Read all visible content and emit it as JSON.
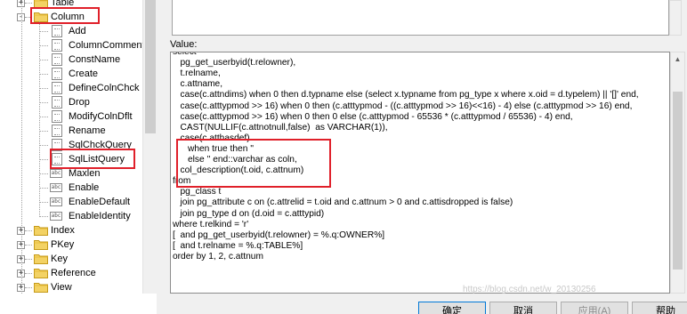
{
  "tree": {
    "items": [
      {
        "label": "Table",
        "kind": "folder",
        "expander": "+"
      },
      {
        "label": "Column",
        "kind": "folder",
        "expander": "-"
      },
      {
        "label": "Add",
        "kind": "doc"
      },
      {
        "label": "ColumnComment",
        "kind": "doc"
      },
      {
        "label": "ConstName",
        "kind": "doc"
      },
      {
        "label": "Create",
        "kind": "doc"
      },
      {
        "label": "DefineColnChck",
        "kind": "doc"
      },
      {
        "label": "Drop",
        "kind": "doc"
      },
      {
        "label": "ModifyColnDflt",
        "kind": "doc"
      },
      {
        "label": "Rename",
        "kind": "doc"
      },
      {
        "label": "SqlChckQuery",
        "kind": "doc"
      },
      {
        "label": "SqlListQuery",
        "kind": "doc"
      },
      {
        "label": "Maxlen",
        "kind": "tag"
      },
      {
        "label": "Enable",
        "kind": "tag"
      },
      {
        "label": "EnableDefault",
        "kind": "tag"
      },
      {
        "label": "EnableIdentity",
        "kind": "tag"
      },
      {
        "label": "Index",
        "kind": "folder",
        "expander": "+"
      },
      {
        "label": "PKey",
        "kind": "folder",
        "expander": "+"
      },
      {
        "label": "Key",
        "kind": "folder",
        "expander": "+"
      },
      {
        "label": "Reference",
        "kind": "folder",
        "expander": "+"
      },
      {
        "label": "View",
        "kind": "folder",
        "expander": "+"
      }
    ]
  },
  "value": {
    "label": "Value:",
    "lines": [
      "select",
      "   pg_get_userbyid(t.relowner),",
      "   t.relname,",
      "   c.attname,",
      "   case(c.attndims) when 0 then d.typname else (select x.typname from pg_type x where x.oid = d.typelem) || '[]' end,",
      "   case(c.atttypmod >> 16) when 0 then (c.atttypmod - ((c.atttypmod >> 16)<<16) - 4) else (c.atttypmod >> 16) end,",
      "   case(c.atttypmod >> 16) when 0 then 0 else (c.atttypmod - 65536 * (c.atttypmod / 65536) - 4) end,",
      "   CAST(NULLIF(c.attnotnull,false)  as VARCHAR(1)),",
      "   case(c.atthasdef)",
      "      when true then ''",
      "      else '' end::varchar as coln,",
      "   col_description(t.oid, c.attnum)",
      "from",
      "   pg_class t",
      "   join pg_attribute c on (c.attrelid = t.oid and c.attnum > 0 and c.attisdropped is false)",
      "   join pg_type d on (d.oid = c.atttypid)",
      "where t.relkind = 'r'",
      "[  and pg_get_userbyid(t.relowner) = %.q:OWNER%]",
      "[  and t.relname = %.q:TABLE%]",
      "order by 1, 2, c.attnum"
    ]
  },
  "buttons": {
    "ok": "确定",
    "cancel": "取消",
    "apply": "应用(A)",
    "help": "帮助"
  },
  "watermark": "https://blog.csdn.net/w_20130256"
}
